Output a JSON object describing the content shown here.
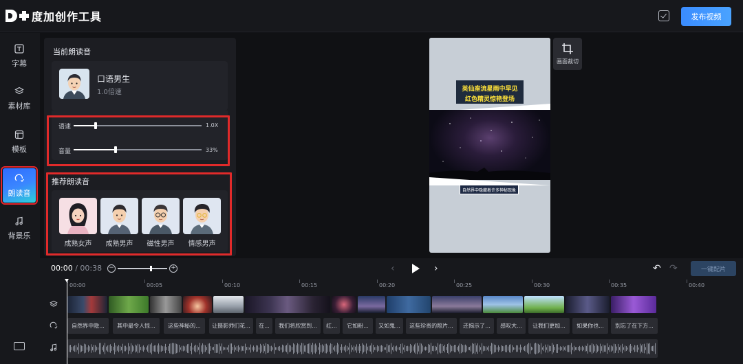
{
  "app": {
    "title": "度加创作工具",
    "publish_label": "发布视频"
  },
  "sidebar": {
    "items": [
      {
        "label": "字幕",
        "icon": "subtitle-icon"
      },
      {
        "label": "素材库",
        "icon": "layers-icon"
      },
      {
        "label": "模板",
        "icon": "template-icon"
      },
      {
        "label": "朗读音",
        "icon": "voice-icon",
        "active": true
      },
      {
        "label": "背景乐",
        "icon": "music-note-icon"
      }
    ],
    "bottom_icon": "keyboard-icon"
  },
  "panel": {
    "current_title": "当前朗读音",
    "current_voice": {
      "name": "口语男生",
      "speed_text": "1.0倍速"
    },
    "sliders": [
      {
        "label": "语速",
        "value_text": "1.0X",
        "level": 0.17
      },
      {
        "label": "音量",
        "value_text": "33%",
        "level": 0.33
      }
    ],
    "recommend_title": "推荐朗读音",
    "recommend": [
      {
        "label": "成熟女声"
      },
      {
        "label": "成熟男声"
      },
      {
        "label": "磁性男声"
      },
      {
        "label": "情感男声"
      }
    ]
  },
  "preview": {
    "caption_line1": "英仙座流星雨中早见",
    "caption_line2": "红色精灵惊艳登场",
    "caption_bottom": "自然界中隐藏着许多神秘现象",
    "crop_label": "画面裁切"
  },
  "controls": {
    "current_time": "00:00",
    "separator": " / ",
    "total_time": "00:38",
    "auto_label": "一键配片"
  },
  "timeline": {
    "ticks": [
      "00:00",
      "00:05",
      "00:10",
      "00:15",
      "00:20",
      "00:25",
      "00:30",
      "00:35",
      "00:40"
    ],
    "subtitles": [
      "自然界中隐...",
      "其中最令人惊...",
      "这些神秘的...",
      "让摄影师们花...",
      "在...",
      "我们将欣赏到...",
      "红...",
      "它如粉...",
      "又如鬼...",
      "这些珍贵的照片...",
      "还揭示了...",
      "感叹大...",
      "让我们更加...",
      "如果你也...",
      "别忘了在下方..."
    ]
  },
  "colors": {
    "accent": "#3a8cff",
    "highlight": "#e02a2a",
    "caption": "#ffe23a"
  }
}
